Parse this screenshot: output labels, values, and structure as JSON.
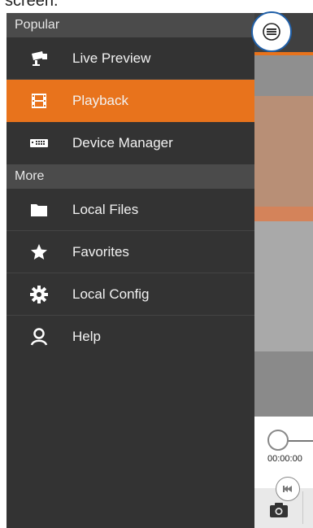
{
  "header_crop_text": "screen.",
  "drawer": {
    "sections": [
      {
        "title": "Popular",
        "items": [
          {
            "label": "Live Preview",
            "icon": "camera-icon"
          },
          {
            "label": "Playback",
            "icon": "film-icon",
            "active": true
          },
          {
            "label": "Device Manager",
            "icon": "device-icon"
          }
        ]
      },
      {
        "title": "More",
        "items": [
          {
            "label": "Local Files",
            "icon": "folder-icon"
          },
          {
            "label": "Favorites",
            "icon": "star-icon"
          },
          {
            "label": "Local Config",
            "icon": "gear-icon"
          },
          {
            "label": "Help",
            "icon": "help-person-icon"
          }
        ]
      }
    ]
  },
  "playback": {
    "time": "00:00:00"
  },
  "colors": {
    "drawer_bg": "#333333",
    "section_bg": "#4b4b4b",
    "active": "#e8731c",
    "toggle_ring": "#1f5fa8"
  }
}
